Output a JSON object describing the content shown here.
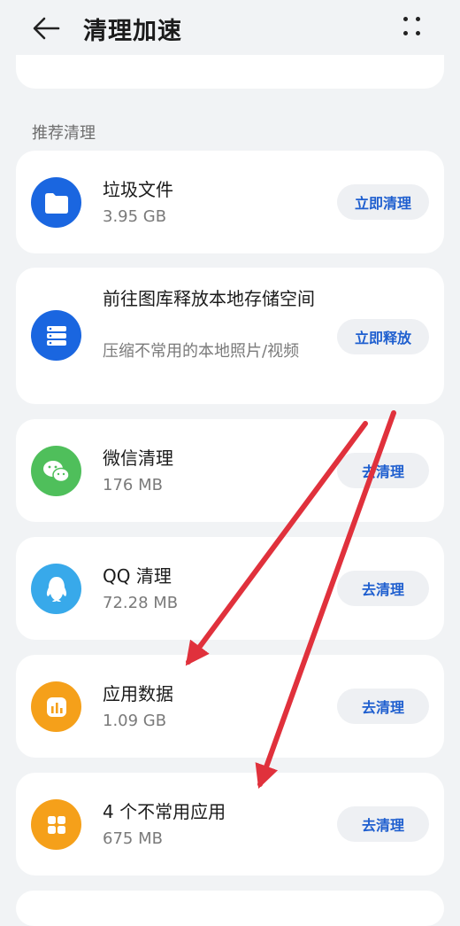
{
  "header": {
    "title": "清理加速",
    "back_icon": "arrow-left-icon",
    "more_icon": "more-dots-icon"
  },
  "section": {
    "title": "推荐清理"
  },
  "items": [
    {
      "icon": "folder-icon",
      "icon_color": "#1a66e0",
      "title": "垃圾文件",
      "subtitle": "3.95 GB",
      "action": "立即清理"
    },
    {
      "icon": "storage-icon",
      "icon_color": "#1a66e0",
      "title": "前往图库释放本地存储空间",
      "subtitle": "压缩不常用的本地照片/视频",
      "action": "立即释放"
    },
    {
      "icon": "wechat-icon",
      "icon_color": "#4fbf5b",
      "title": "微信清理",
      "subtitle": "176 MB",
      "action": "去清理"
    },
    {
      "icon": "qq-penguin-icon",
      "icon_color": "#38a9ea",
      "title": "QQ 清理",
      "subtitle": "72.28 MB",
      "action": "去清理"
    },
    {
      "icon": "app-data-icon",
      "icon_color": "#f5a01a",
      "title": "应用数据",
      "subtitle": "1.09 GB",
      "action": "去清理"
    },
    {
      "icon": "apps-grid-icon",
      "icon_color": "#f5a01a",
      "title": "4 个不常用应用",
      "subtitle": "675 MB",
      "action": "去清理"
    }
  ],
  "colors": {
    "background": "#f1f3f5",
    "card": "#ffffff",
    "accent_text": "#1f5fcf",
    "annotation_arrow": "#e0313c"
  }
}
